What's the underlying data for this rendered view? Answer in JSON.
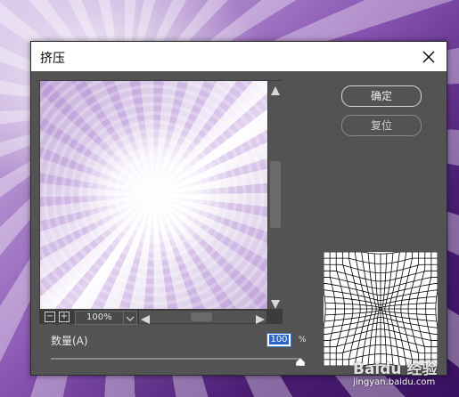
{
  "dialog": {
    "title": "挤压",
    "close_icon": "close-icon"
  },
  "preview": {
    "zoom_out_symbol": "−",
    "zoom_in_symbol": "+",
    "zoom_value": "100%"
  },
  "buttons": {
    "ok_label": "确定",
    "reset_label": "复位"
  },
  "amount": {
    "label": "数量(A)",
    "value": "100",
    "unit": "%",
    "slider_min": -100,
    "slider_max": 100,
    "slider_value": 100
  },
  "watermark": {
    "logo": "Baidu 经验",
    "url": "jingyan.baidu.com"
  },
  "colors": {
    "dialog_bg": "#535353",
    "accent": "#2a64c4"
  }
}
